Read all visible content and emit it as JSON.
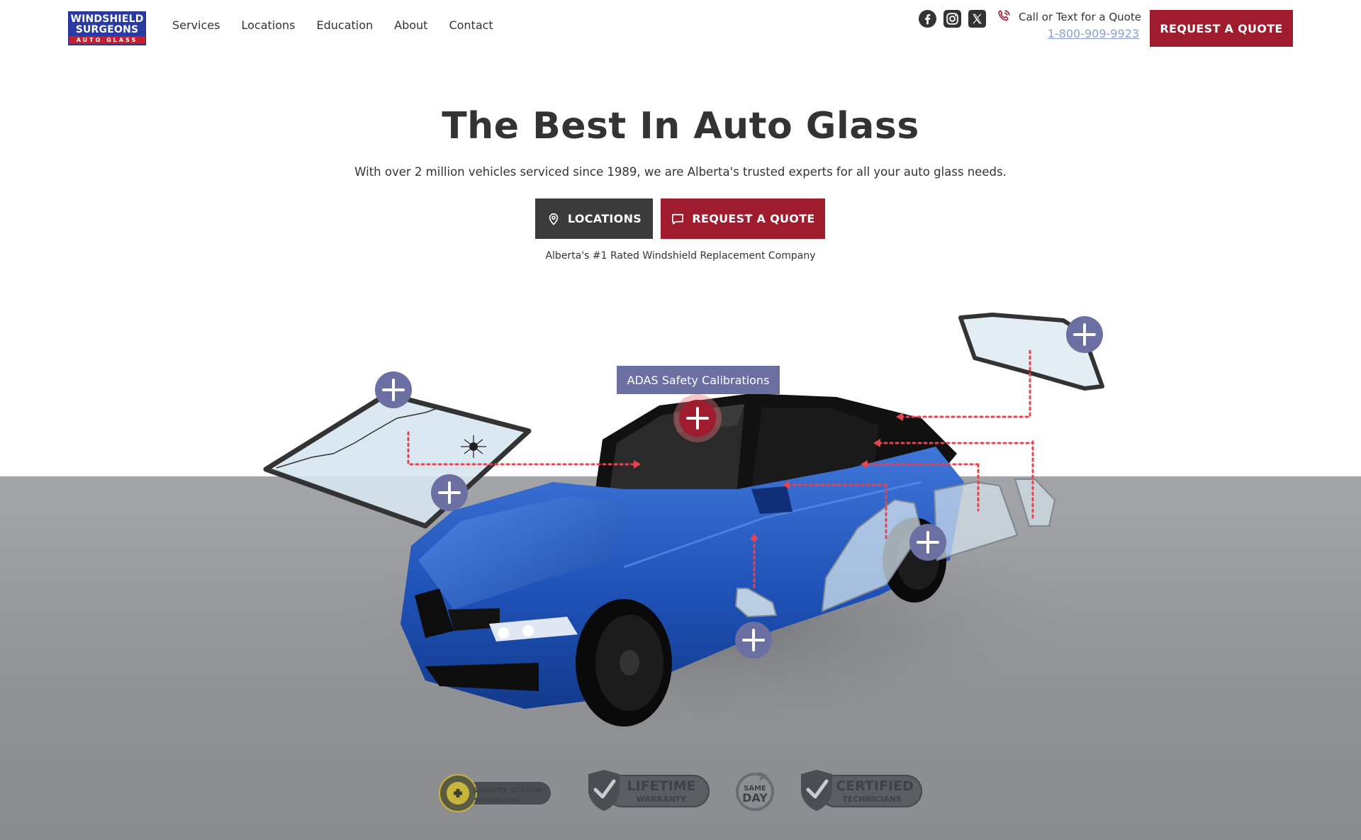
{
  "header": {
    "logo": {
      "line1": "WINDSHIELD",
      "line2": "SURGEONS",
      "line3": "AUTO GLASS"
    },
    "nav": [
      {
        "label": "Services"
      },
      {
        "label": "Locations"
      },
      {
        "label": "Education"
      },
      {
        "label": "About"
      },
      {
        "label": "Contact"
      }
    ],
    "socials": [
      {
        "icon": "facebook-icon"
      },
      {
        "icon": "instagram-icon"
      },
      {
        "icon": "x-twitter-icon"
      }
    ],
    "call_label": "Call or Text for a Quote",
    "phone": "1-800-909-9923",
    "quote_button": "REQUEST A QUOTE"
  },
  "hero": {
    "title": "The Best In Auto Glass",
    "subtitle": "With over 2 million vehicles serviced since 1989, we are Alberta's trusted experts for all your auto glass needs.",
    "locations_button": "LOCATIONS",
    "quote_button": "REQUEST A QUOTE",
    "rated": "Alberta's #1 Rated Windshield Replacement Company"
  },
  "stage": {
    "tooltip": "ADAS Safety Calibrations",
    "hotspots": [
      "windshield-top",
      "windshield",
      "adas-camera",
      "rear-window",
      "rear-side-window",
      "front-side-window"
    ]
  },
  "badges": [
    {
      "line1": "SAFETY FIRST",
      "line2": "SAFEFTY SYSTEM",
      "line3": "SPECIALISTS"
    },
    {
      "line1": "LIFETIME",
      "line2": "WARRANTY"
    },
    {
      "line1": "SAME",
      "line2": "DAY"
    },
    {
      "line1": "CERTIFIED",
      "line2": "TECHNICIANS"
    }
  ],
  "colors": {
    "brand_red": "#9f1b2e",
    "brand_blue": "#2a3aa4",
    "dark_button": "#3b3b3b",
    "hotspot": "#6b6fa2",
    "connector": "#e8434f",
    "phone_link": "#8c9fd6"
  }
}
